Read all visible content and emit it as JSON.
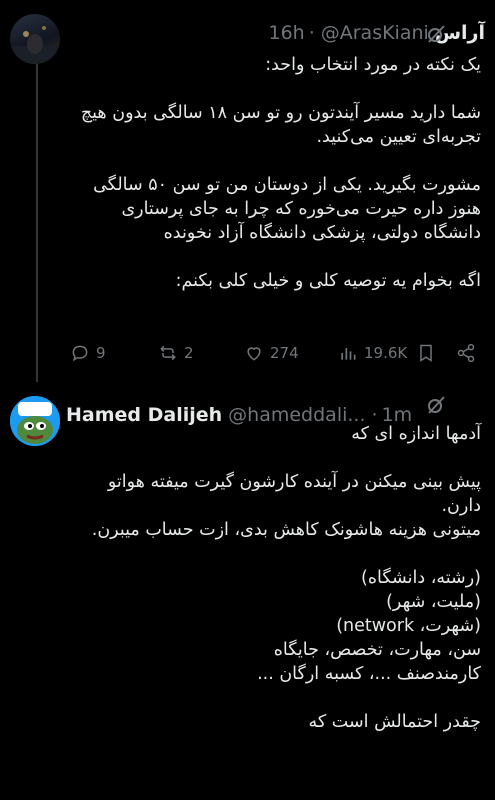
{
  "tweet1": {
    "author_name": "آراس",
    "handle": "@ArasKiani",
    "separator": "·",
    "time": "16h",
    "body_lines": [
      "یک نکته در مورد انتخاب واحد:",
      "",
      "شما دارید مسیر آیندتون رو تو سن ۱۸ سالگی بدون هیچ",
      "تجربه‌ای تعیین می‌کنید.",
      "",
      "مشورت بگیرید. یکی از دوستان من تو سن ۵۰ سالگی",
      "هنوز داره حیرت می‌خوره که چرا به جای پرستاری",
      "دانشگاه دولتی، پزشکی دانشگاه آزاد نخونده",
      "",
      "اگه بخوام یه توصیه کلی و خیلی کلی بکنم:"
    ],
    "actions": {
      "replies": "9",
      "reposts": "2",
      "likes": "274",
      "views": "19.6K"
    }
  },
  "tweet2": {
    "author_name": "Hamed Dalijeh",
    "handle": "@hameddali...",
    "separator": "·",
    "time": "1m",
    "body_lines": [
      "آدمها اندازه ای که",
      "",
      "پیش بینی میکنن در آینده کارشون گیرت میفته هواتو",
      "دارن.",
      "میتونی هزینه هاشونک کاهش بدی، ازت حساب میبرن.",
      "",
      "(رشته، دانشگاه)",
      "(ملیت، شهر)",
      "(شهرت، network)",
      "سن، مهارت، تخصص، جایگاه",
      "کارمندصنف ...، کسبه ارگان ...",
      "",
      "چقدر احتمالش است که"
    ]
  },
  "icons": [
    "grok-icon",
    "reply-icon",
    "repost-icon",
    "like-icon",
    "views-icon",
    "bookmark-icon",
    "share-icon"
  ],
  "colors": {
    "background": "#000000",
    "text": "#e7e9ea",
    "muted": "#71767b",
    "thread_line": "#333639"
  }
}
